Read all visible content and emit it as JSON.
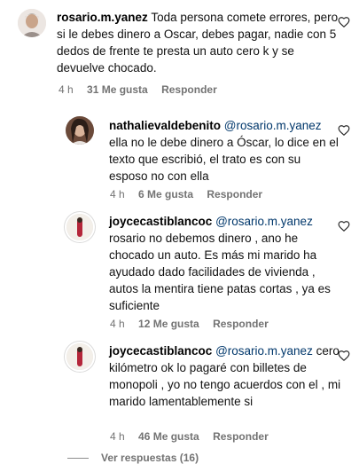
{
  "comments": [
    {
      "username": "rosario.m.yanez",
      "mention": "",
      "text": "Toda persona comete errores, pero si le debes dinero a Oscar, debes pagar, nadie con 5 dedos de frente te presta un auto cero k y se devuelve chocado.",
      "time": "4 h",
      "likes": "31 Me gusta",
      "reply": "Responder"
    },
    {
      "username": "nathalievaldebenito",
      "mention": "@rosario.m.yanez",
      "text": "ella no le debe dinero a Óscar, lo dice en el texto que escribió, el trato es con su esposo no con ella",
      "time": "4 h",
      "likes": "6 Me gusta",
      "reply": "Responder"
    },
    {
      "username": "joycecastiblancoc",
      "mention": "@rosario.m.yanez",
      "text": "rosario no debemos dinero , ano he chocado un auto. Es más mi marido ha ayudado dado facilidades de vivienda , autos la mentira tiene patas cortas , ya es suficiente",
      "time": "4 h",
      "likes": "12 Me gusta",
      "reply": "Responder"
    },
    {
      "username": "joycecastiblancoc",
      "mention": "@rosario.m.yanez",
      "text": "cero kilómetro ok lo pagaré con billetes de monopoli , yo no tengo acuerdos con el , mi marido lamentablemente si",
      "time": "4 h",
      "likes": "46 Me gusta",
      "reply": "Responder"
    }
  ],
  "view_replies": "Ver respuestas (16)",
  "icons": {
    "like": "heart-outline-icon"
  }
}
